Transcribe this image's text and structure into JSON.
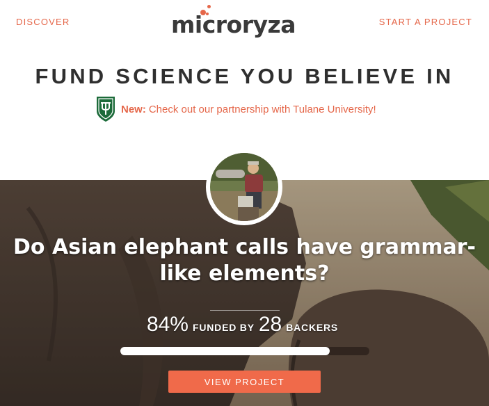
{
  "nav": {
    "discover_label": "DISCOVER",
    "start_project_label": "START A PROJECT"
  },
  "logo": {
    "text": "microryza"
  },
  "tagline": "FUND SCIENCE YOU BELIEVE IN",
  "partner": {
    "prefix": "New:",
    "text": "Check out our partnership with Tulane University!",
    "icon": "tulane-shield-icon"
  },
  "project": {
    "title": "Do Asian elephant calls have grammar-like elements?",
    "percent_funded": "84%",
    "funded_by_label": "FUNDED BY",
    "backers_count": "28",
    "backers_label": "BACKERS",
    "progress_fraction": 0.84,
    "view_button_label": "VIEW PROJECT"
  },
  "colors": {
    "accent": "#e5674a",
    "button": "#f06a4a",
    "tulane_green": "#1c6b3a"
  }
}
